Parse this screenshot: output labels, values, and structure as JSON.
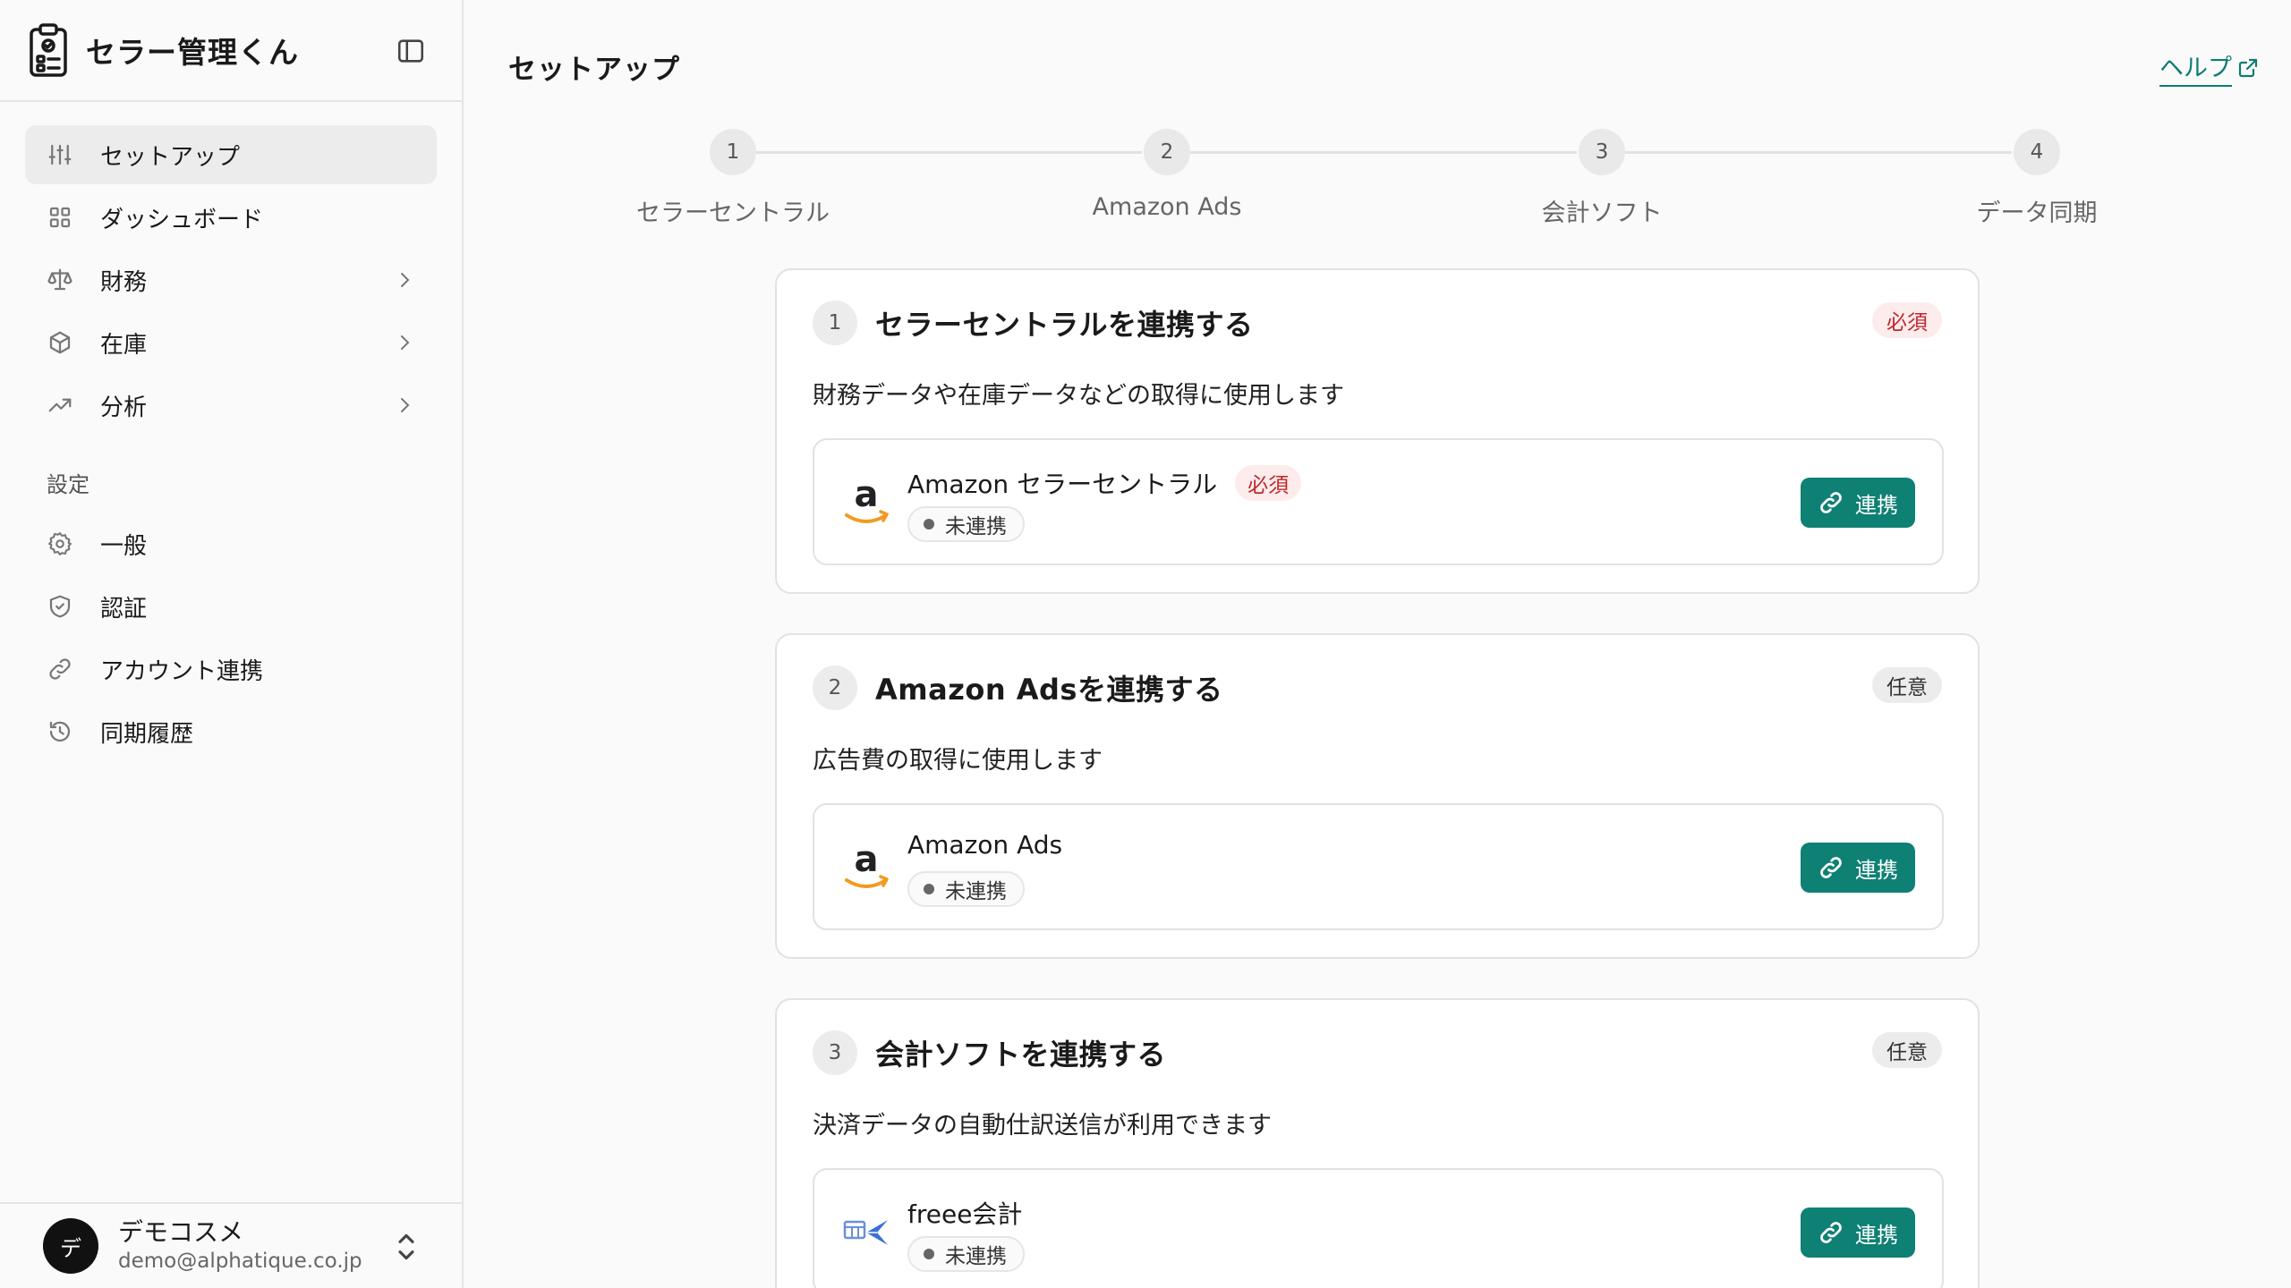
{
  "app": {
    "name": "セラー管理くん"
  },
  "sidebar": {
    "items": [
      {
        "label": "セットアップ",
        "icon": "sliders-icon",
        "active": true
      },
      {
        "label": "ダッシュボード",
        "icon": "grid-icon"
      },
      {
        "label": "財務",
        "icon": "scale-icon",
        "chevron": true
      },
      {
        "label": "在庫",
        "icon": "box-icon",
        "chevron": true
      },
      {
        "label": "分析",
        "icon": "trend-icon",
        "chevron": true
      }
    ],
    "section_label": "設定",
    "settings_items": [
      {
        "label": "一般",
        "icon": "gear-icon"
      },
      {
        "label": "認証",
        "icon": "shield-icon"
      },
      {
        "label": "アカウント連携",
        "icon": "link-icon"
      },
      {
        "label": "同期履歴",
        "icon": "history-icon"
      }
    ]
  },
  "user": {
    "initial": "デ",
    "name": "デモコスメ",
    "email": "demo@alphatique.co.jp"
  },
  "header": {
    "title": "セットアップ",
    "help_label": "ヘルプ"
  },
  "stepper": {
    "steps": [
      {
        "number": "1",
        "label": "セラーセントラル"
      },
      {
        "number": "2",
        "label": "Amazon Ads"
      },
      {
        "number": "3",
        "label": "会計ソフト"
      },
      {
        "number": "4",
        "label": "データ同期"
      }
    ]
  },
  "cards": [
    {
      "number": "1",
      "title": "セラーセントラルを連携する",
      "badge": "必須",
      "badge_type": "required",
      "description": "財務データや在庫データなどの取得に使用します",
      "connection": {
        "name": "Amazon セラーセントラル",
        "name_badge": "必須",
        "status": "未連携",
        "logo": "amazon-logo-icon",
        "button": "連携"
      }
    },
    {
      "number": "2",
      "title": "Amazon Adsを連携する",
      "badge": "任意",
      "badge_type": "optional",
      "description": "広告費の取得に使用します",
      "connection": {
        "name": "Amazon Ads",
        "status": "未連携",
        "logo": "amazon-logo-icon",
        "button": "連携"
      }
    },
    {
      "number": "3",
      "title": "会計ソフトを連携する",
      "badge": "任意",
      "badge_type": "optional",
      "description": "決済データの自動仕訳送信が利用できます",
      "connection": {
        "name": "freee会計",
        "status": "未連携",
        "logo": "freee-logo-icon",
        "button": "連携"
      }
    }
  ],
  "colors": {
    "accent": "#0e8074",
    "required_text": "#c0262d",
    "required_bg": "#fdecec"
  }
}
